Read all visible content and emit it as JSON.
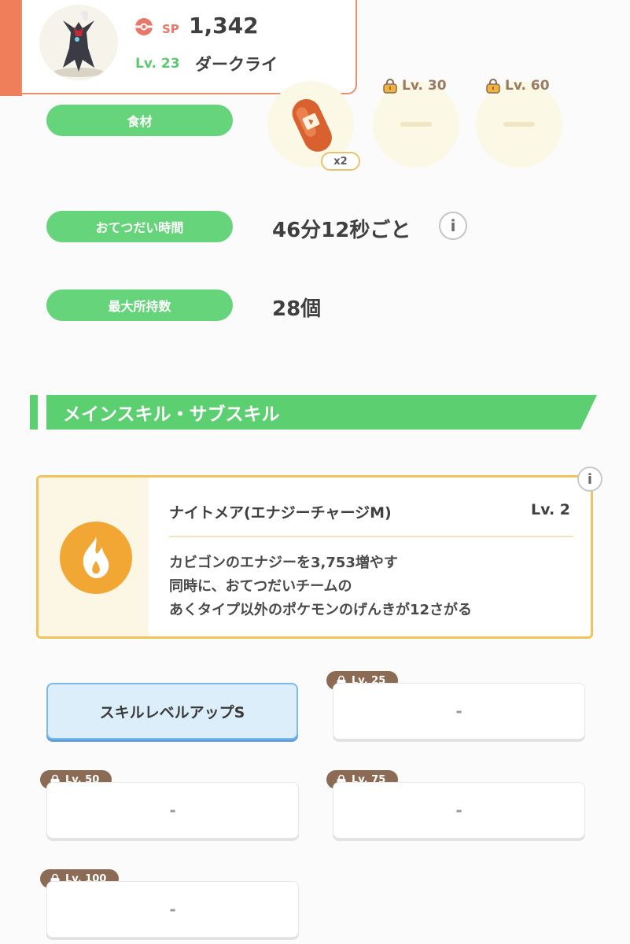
{
  "header": {
    "sp_label": "SP",
    "sp_value": "1,342",
    "level": "Lv. 23",
    "name": "ダークライ",
    "accent": "#ef7f5b"
  },
  "ingredients": {
    "label": "食材",
    "count": "x2",
    "locked": [
      {
        "level": "Lv. 30"
      },
      {
        "level": "Lv. 60"
      }
    ]
  },
  "help_time": {
    "label": "おてつだい時間",
    "value": "46分12秒ごと",
    "info_icon": "i"
  },
  "max_carry": {
    "label": "最大所持数",
    "value": "28個"
  },
  "section": {
    "title": "メインスキル・サブスキル"
  },
  "main_skill": {
    "name": "ナイトメア(エナジーチャージM)",
    "level": "Lv. 2",
    "description": [
      "カビゴンのエナジーを3,753増やす",
      "同時に、おてつだいチームの",
      "あくタイプ以外のポケモンのげんきが12さがる"
    ],
    "info_icon": "i",
    "icon": "flame-icon"
  },
  "sub_skills": [
    {
      "label": "スキルレベルアップS",
      "level": ""
    },
    {
      "label": "-",
      "level": "Lv. 25"
    },
    {
      "label": "-",
      "level": "Lv. 50"
    },
    {
      "label": "-",
      "level": "Lv. 75"
    },
    {
      "label": "-",
      "level": "Lv. 100"
    }
  ]
}
